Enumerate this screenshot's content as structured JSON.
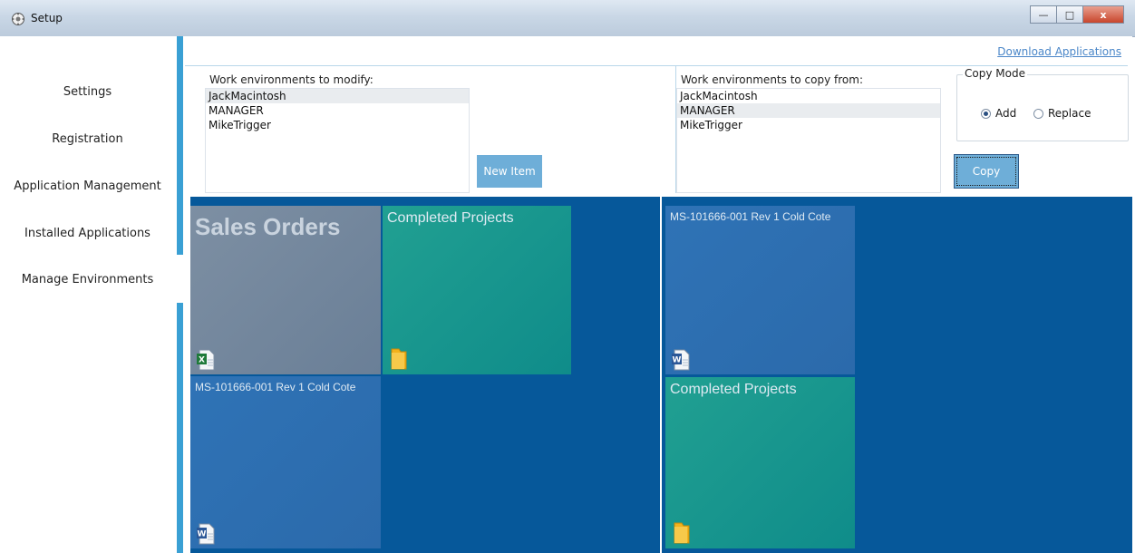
{
  "window": {
    "title": "Setup",
    "buttons": {
      "minimize": "—",
      "maximize": "□",
      "close": "x"
    }
  },
  "sidebar": {
    "items": [
      {
        "label": "Settings"
      },
      {
        "label": "Registration"
      },
      {
        "label": "Application Management"
      },
      {
        "label": "Installed Applications"
      },
      {
        "label": "Manage Environments"
      }
    ]
  },
  "header": {
    "download_link": "Download Applications"
  },
  "modify": {
    "label": "Work environments to modify:",
    "items": [
      "JackMacintosh",
      "MANAGER",
      "MikeTrigger"
    ],
    "selected_index": 0,
    "new_button": "New Item"
  },
  "copy_from": {
    "label": "Work environments to copy from:",
    "items": [
      "JackMacintosh",
      "MANAGER",
      "MikeTrigger"
    ],
    "selected_index": 1,
    "copy_button": "Copy"
  },
  "copy_mode": {
    "title": "Copy Mode",
    "options": [
      {
        "label": "Add",
        "checked": true
      },
      {
        "label": "Replace",
        "checked": false
      }
    ]
  },
  "left_tiles": [
    {
      "title": "Sales Orders",
      "icon": "excel-file-icon"
    },
    {
      "title": "Completed Projects",
      "icon": "folder-icon"
    },
    {
      "title": "MS-101666-001 Rev 1 Cold Cote",
      "icon": "word-file-icon"
    }
  ],
  "right_tiles": [
    {
      "title": "MS-101666-001 Rev 1 Cold Cote",
      "icon": "word-file-icon"
    },
    {
      "title": "Completed Projects",
      "icon": "folder-icon"
    }
  ],
  "colors": {
    "accent": "#3aa0d4",
    "button": "#6eaed8",
    "tile_bg": "#06589a",
    "tile_gray": "#6f8399",
    "tile_teal": "#14918b",
    "tile_blue": "#2c6eb0"
  }
}
